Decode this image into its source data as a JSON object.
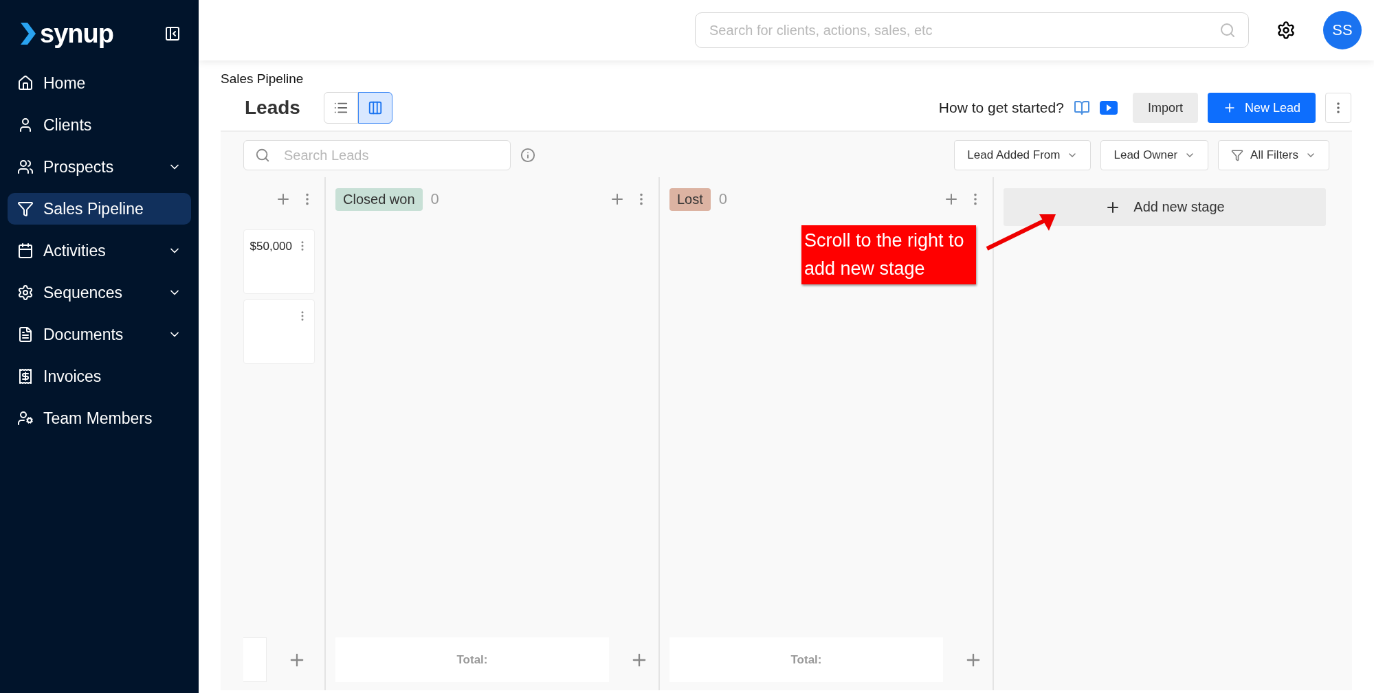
{
  "sidebar": {
    "logo": "synup",
    "items": [
      {
        "label": "Home",
        "selected": false,
        "expandable": false
      },
      {
        "label": "Clients",
        "selected": false,
        "expandable": false
      },
      {
        "label": "Prospects",
        "selected": false,
        "expandable": true
      },
      {
        "label": "Sales Pipeline",
        "selected": true,
        "expandable": false
      },
      {
        "label": "Activities",
        "selected": false,
        "expandable": true
      },
      {
        "label": "Sequences",
        "selected": false,
        "expandable": true
      },
      {
        "label": "Documents",
        "selected": false,
        "expandable": true
      },
      {
        "label": "Invoices",
        "selected": false,
        "expandable": false
      },
      {
        "label": "Team Members",
        "selected": false,
        "expandable": false
      }
    ]
  },
  "topbar": {
    "search": {
      "placeholder": "Search for clients, actions, sales, etc"
    },
    "avatar": "SS"
  },
  "breadcrumb": "Sales Pipeline",
  "header": {
    "title": "Leads",
    "views": [
      {
        "kind": "list",
        "selected": false
      },
      {
        "kind": "board",
        "selected": true
      }
    ],
    "help": "How to get started?",
    "import": "Import",
    "new_lead": "New Lead"
  },
  "filters": {
    "search": {
      "placeholder": "Search Leads"
    },
    "dropdowns": [
      {
        "label": "Lead Added From",
        "kind": "plain"
      },
      {
        "label": "Lead Owner",
        "kind": "plain"
      },
      {
        "label": "All Filters",
        "kind": "filter"
      }
    ]
  },
  "partial_column": {
    "cards": [
      {
        "kind": "amount",
        "amount": "$50,000"
      },
      {
        "kind": "blank"
      }
    ]
  },
  "columns": [
    {
      "name": "Closed won",
      "count": "0",
      "color": "#c8e0d6",
      "total": "Total:"
    },
    {
      "name": "Lost",
      "count": "0",
      "color": "#dcb3a2",
      "total": "Total:"
    }
  ],
  "add_stage": "Add new stage",
  "annotation": "Scroll to the right to add new stage"
}
